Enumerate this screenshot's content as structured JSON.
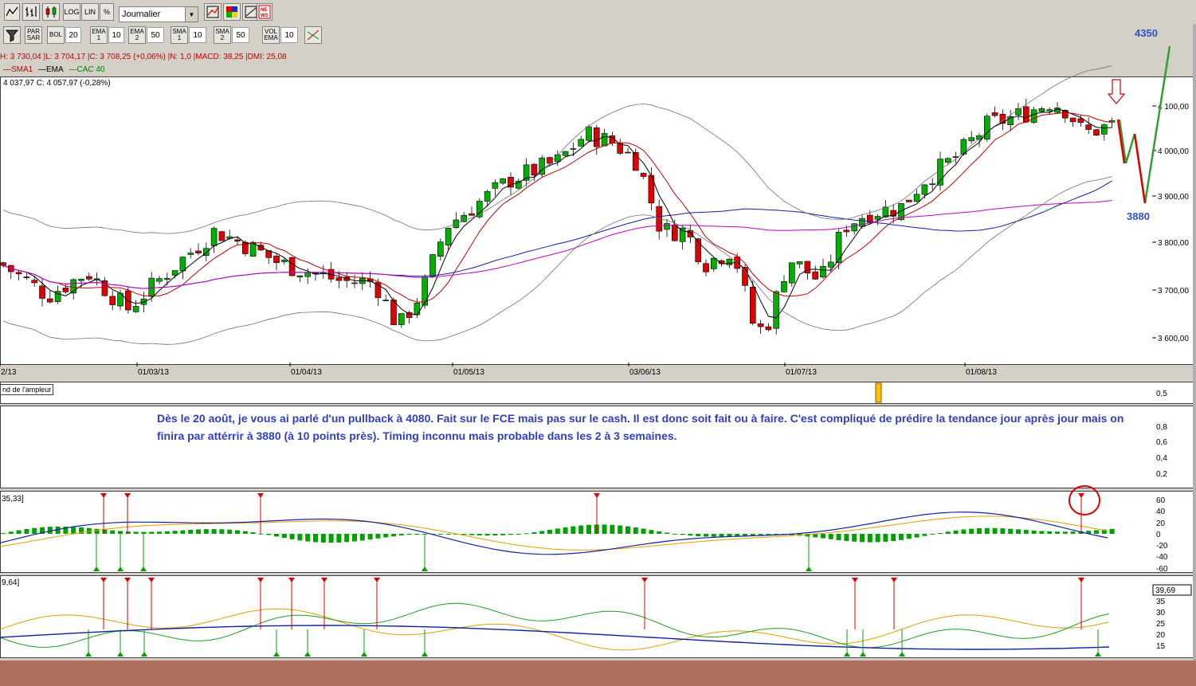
{
  "toolbar1": {
    "buttons": [
      "LOG",
      "LIN",
      "%"
    ],
    "period_select": "Journalier"
  },
  "toolbar2": {
    "indicators": [
      {
        "label": "PAR SAR",
        "value": ""
      },
      {
        "label": "BOL",
        "value": "20"
      },
      {
        "label": "EMA 1",
        "value": "10"
      },
      {
        "label": "EMA 2",
        "value": "50"
      },
      {
        "label": "SMA 1",
        "value": "10"
      },
      {
        "label": "SMA 2",
        "value": "50"
      },
      {
        "label": "VOL EMA",
        "value": "10"
      }
    ]
  },
  "info_line": "H: 3 730,04 |L: 3 704,17 |C: 3 708,25 (+0,06%) |N: 1,0 |MACD: 38,25 |DMI: 25,08",
  "legend": {
    "sma": "SMA1",
    "ema": "EMA",
    "cac": "CAC 40"
  },
  "ohlc_line": "4 037,97  C: 4 057,97 (-0,28%)",
  "price_axis": [
    "4 100,00",
    "4 000,00",
    "3 900,00",
    "3 800,00",
    "3 700,00",
    "3 600,00"
  ],
  "date_axis": [
    "2/13",
    "01/03/13",
    "01/04/13",
    "01/05/13",
    "03/06/13",
    "01/07/13",
    "01/08/13"
  ],
  "annotations": {
    "target_high": "4350",
    "target_low": "3880"
  },
  "ampleur_label": "nd de l'ampleur",
  "ampleur_axis": [
    "0,5"
  ],
  "comment_axis": [
    "0,8",
    "0,6",
    "0,4",
    "0,2"
  ],
  "comment_text": "Dès le 20 août, je vous ai parlé d'un pullback à 4080. Fait sur le FCE mais pas sur le cash. Il est donc soit fait ou à faire. C'est compliqué de prédire la tendance jour après jour mais on finira par attérrir à 3880 (à 10 points près). Timing inconnu mais probable dans les 2 à 3 semaines.",
  "macd_label": "35,33]",
  "macd_axis": [
    "60",
    "40",
    "20",
    "0",
    "-20",
    "-40",
    "-60"
  ],
  "dmi_label": "9,64]",
  "dmi_value": "39,69",
  "dmi_axis": [
    "35",
    "30",
    "25",
    "20",
    "15"
  ],
  "colors": {
    "bull": "#00b000",
    "bear": "#e00000",
    "comment": "#2f3fc0",
    "annotation": "#3050d0",
    "forecast": "#30a030"
  }
}
